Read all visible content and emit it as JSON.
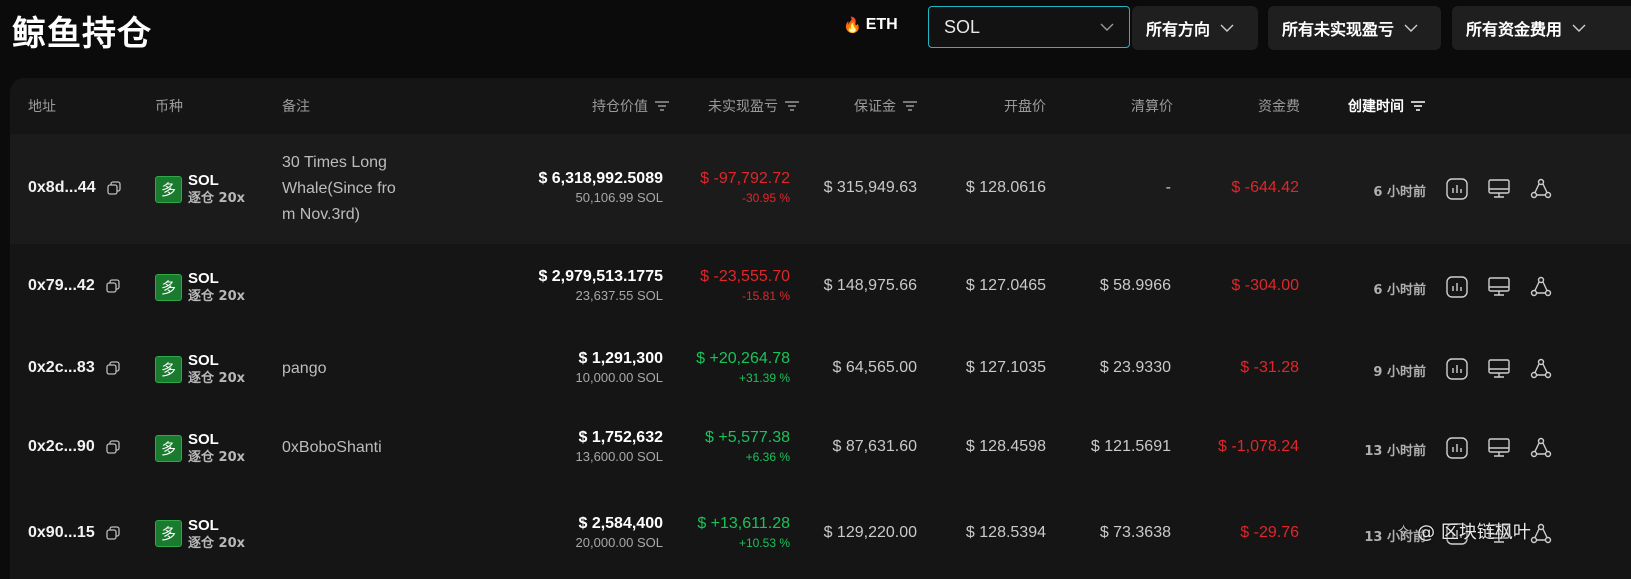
{
  "page": {
    "title": "鲸鱼持仓"
  },
  "filters": {
    "eth_label": "ETH",
    "eth_icon": "fire-icon",
    "coin_select": "SOL",
    "direction": "所有方向",
    "pnl": "所有未实现盈亏",
    "funding": "所有资金费用"
  },
  "columns": {
    "address": "地址",
    "coin": "币种",
    "note": "备注",
    "position_value": "持仓价值",
    "unrealized_pnl": "未实现盈亏",
    "margin": "保证金",
    "entry_price": "开盘价",
    "liq_price": "清算价",
    "funding_fee": "资金费",
    "created": "创建时间"
  },
  "colors": {
    "accent": "#1eb8c4",
    "loss": "#e0262b",
    "gain": "#19c35a",
    "long_badge": "#1a7a2e"
  },
  "rows": [
    {
      "address": "0x8d...44",
      "side": "多",
      "coin": "SOL",
      "leverage": "逐仓 20x",
      "note_lines": [
        "30 Times Long",
        "Whale(Since fro",
        "m Nov.3rd)"
      ],
      "value": "$ 6,318,992.5089",
      "size": "50,106.99 SOL",
      "pnl": "$ -97,792.72",
      "pnl_pct": "-30.95 %",
      "pnl_sign": "neg",
      "margin": "$ 315,949.63",
      "entry": "$ 128.0616",
      "liq": "-",
      "fee": "$ -644.42",
      "time": "6 小时前"
    },
    {
      "address": "0x79...42",
      "side": "多",
      "coin": "SOL",
      "leverage": "逐仓 20x",
      "note_lines": [],
      "value": "$ 2,979,513.1775",
      "size": "23,637.55 SOL",
      "pnl": "$ -23,555.70",
      "pnl_pct": "-15.81 %",
      "pnl_sign": "neg",
      "margin": "$ 148,975.66",
      "entry": "$ 127.0465",
      "liq": "$ 58.9966",
      "fee": "$ -304.00",
      "time": "6 小时前"
    },
    {
      "address": "0x2c...83",
      "side": "多",
      "coin": "SOL",
      "leverage": "逐仓 20x",
      "note_lines": [
        "pango"
      ],
      "value": "$ 1,291,300",
      "size": "10,000.00 SOL",
      "pnl": "$ +20,264.78",
      "pnl_pct": "+31.39 %",
      "pnl_sign": "pos",
      "margin": "$ 64,565.00",
      "entry": "$ 127.1035",
      "liq": "$ 23.9330",
      "fee": "$ -31.28",
      "time": "9 小时前"
    },
    {
      "address": "0x2c...90",
      "side": "多",
      "coin": "SOL",
      "leverage": "逐仓 20x",
      "note_lines": [
        "0xBoboShanti"
      ],
      "value": "$ 1,752,632",
      "size": "13,600.00 SOL",
      "pnl": "$ +5,577.38",
      "pnl_pct": "+6.36 %",
      "pnl_sign": "pos",
      "margin": "$ 87,631.60",
      "entry": "$ 128.4598",
      "liq": "$ 121.5691",
      "fee": "$ -1,078.24",
      "time": "13 小时前"
    },
    {
      "address": "0x90...15",
      "side": "多",
      "coin": "SOL",
      "leverage": "逐仓 20x",
      "note_lines": [],
      "value": "$ 2,584,400",
      "size": "20,000.00 SOL",
      "pnl": "$ +13,611.28",
      "pnl_pct": "+10.53 %",
      "pnl_sign": "pos",
      "margin": "$ 129,220.00",
      "entry": "$ 128.5394",
      "liq": "$ 73.3638",
      "fee": "$ -29.76",
      "time": "13 小时前"
    }
  ],
  "row_actions": [
    "chart-icon",
    "monitor-icon",
    "share-icon"
  ],
  "watermark": {
    "text": "@ 区块链枫叶"
  }
}
